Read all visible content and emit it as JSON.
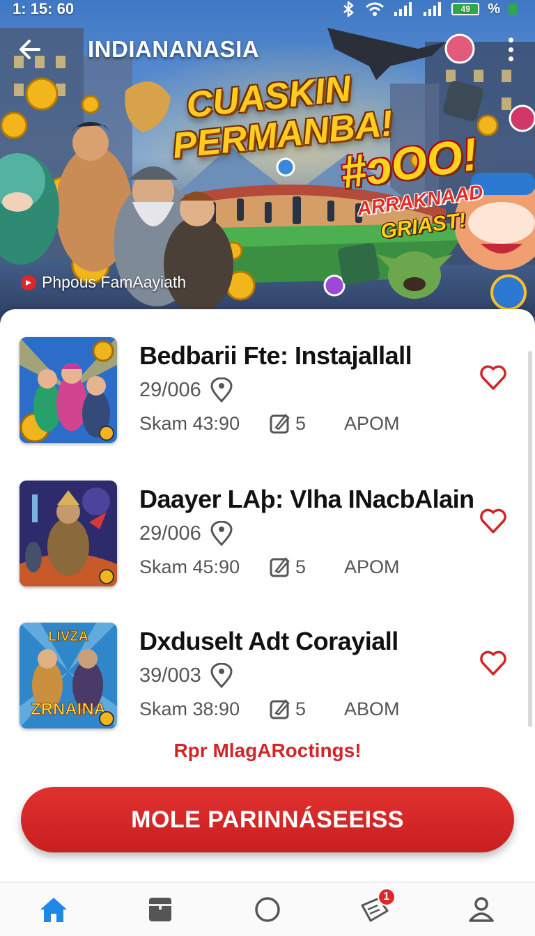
{
  "status_bar": {
    "time": "1: 15: 60",
    "battery": "49",
    "percent_symbol": "%"
  },
  "header": {
    "title": "INDIANANASIA"
  },
  "banner": {
    "headline_line1": "CUASKIN",
    "headline_line2": "PERMANBA!",
    "amount": "#ɔOO!",
    "sub_line1": "ARRAKNAAD",
    "sub_line2": "GRIAST!",
    "caption": "Phpous FamAayiath"
  },
  "games": [
    {
      "title": "Bedbarii Fte: Instajallall",
      "date": "29/006",
      "time": "Skam 43:90",
      "count": "5",
      "status": "APOM"
    },
    {
      "title": "Daayer LAþ: Vlha INacbAlain",
      "date": "29/006",
      "time": "Skam 45:90",
      "count": "5",
      "status": "APOM"
    },
    {
      "title": "Dxduselt Adt Corayiall",
      "date": "39/003",
      "time": "Skam 38:90",
      "count": "5",
      "status": "ABOM"
    }
  ],
  "thumb_text": {
    "game3_top": "LIVZA",
    "game3_bottom": "ZRNAINA"
  },
  "promo_text": "Rpr MlagARoctings!",
  "cta": {
    "label": "MOLE PARINNÁSEEISS"
  },
  "bottom_nav": {
    "items": [
      "home-icon",
      "wallet-icon",
      "circle-icon",
      "tickets-icon",
      "profile-icon"
    ],
    "active": "home-icon",
    "tickets_badge": "1"
  },
  "colors": {
    "accent_red": "#d02628",
    "active_nav": "#1e88e5",
    "inactive_nav": "#555555"
  }
}
